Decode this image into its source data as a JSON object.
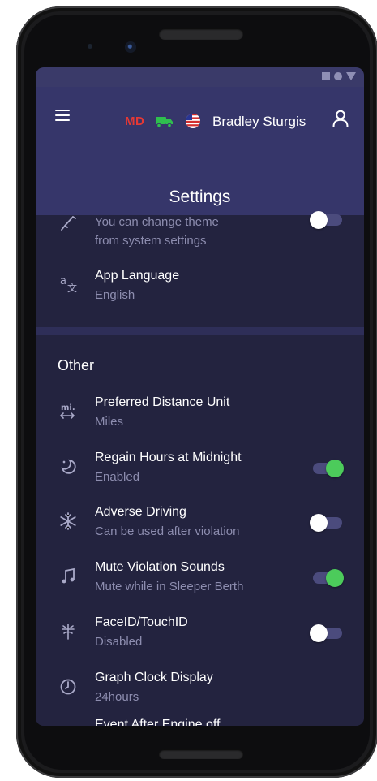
{
  "status_bar": {
    "icons": [
      "square-icon",
      "circle-icon",
      "triangle-icon"
    ]
  },
  "header": {
    "badge": "MD",
    "username": "Bradley Sturgis",
    "title": "Settings",
    "icons": [
      "menu-icon",
      "truck-icon",
      "us-flag-icon",
      "user-icon"
    ]
  },
  "theme_row": {
    "subtitle_line1": "You can change theme",
    "subtitle_line2": "from system settings",
    "toggle": "off"
  },
  "language_row": {
    "title": "App Language",
    "subtitle": "English"
  },
  "other_section": {
    "title": "Other",
    "items": [
      {
        "title": "Preferred Distance Unit",
        "subtitle": "Miles",
        "icon": "distance-unit-icon"
      },
      {
        "title": "Regain Hours at Midnight",
        "subtitle": "Enabled",
        "icon": "moon-clock-icon",
        "toggle": "on"
      },
      {
        "title": "Adverse Driving",
        "subtitle": "Can be used after violation",
        "icon": "snowflake-icon",
        "toggle": "off"
      },
      {
        "title": "Mute Violation Sounds",
        "subtitle": "Mute while in Sleeper Berth",
        "icon": "music-note-icon",
        "toggle": "on"
      },
      {
        "title": "FaceID/TouchID",
        "subtitle": "Disabled",
        "icon": "fingerprint-icon",
        "toggle": "off"
      },
      {
        "title": "Graph Clock Display",
        "subtitle": "24hours",
        "icon": "clock-icon"
      },
      {
        "title": "Event After Engine off"
      }
    ]
  },
  "colors": {
    "background": "#23233f",
    "header": "#36366a",
    "accent_green": "#4ccb5b",
    "md_red": "#e53935"
  }
}
